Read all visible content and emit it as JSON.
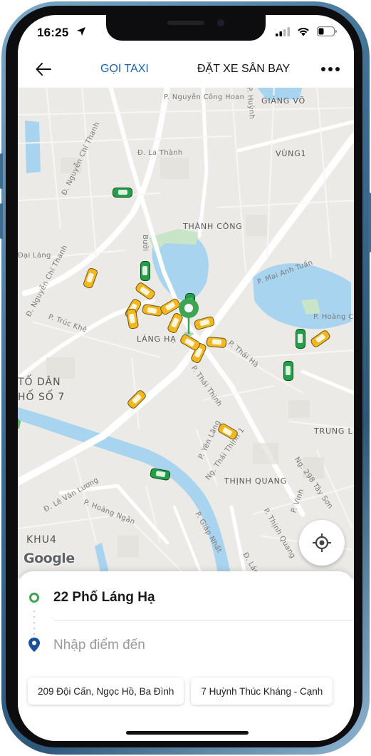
{
  "status_bar": {
    "time": "16:25"
  },
  "header": {
    "tabs": [
      {
        "label": "GỌI TAXI",
        "active": true
      },
      {
        "label": "ĐẶT XE SÂN BAY",
        "active": false
      }
    ],
    "accent_color": "#1c64b0"
  },
  "map": {
    "area_labels": [
      "GIẢNG VÕ",
      "VÙNG1",
      "THÀNH CÔNG",
      "LÁNG HẠ",
      "TỐ DÂN",
      "HỐ SỐ 7",
      "TRUNG L",
      "THỊNH QUANG",
      "KHU4"
    ],
    "street_labels": [
      "P. Nguyễn Công Hoan",
      "Đ. La Thành",
      "Đ. Nguyễn Chí Thanh",
      "Đ. Nguyễn Chí Thanh",
      "Đại Láng",
      "P. Trúc Khê",
      "P. Mai Anh Tuấn",
      "P. Hoàng Cầu",
      "P. Thái Hà",
      "P. Thái Thịnh",
      "P. Yên Lãng",
      "Ng. Thái Thịnh 1",
      "Ng. 298 Tây Sơn",
      "Đ. Lê Văn Lương",
      "P. Hoàng Ngân",
      "P. Giáp Nhất",
      "P. Vinh",
      "P. Thịnh Quang",
      "Đ. Lán",
      "Bưởi",
      "P. Huỳnh"
    ],
    "attribution": "Google"
  },
  "trip": {
    "pickup": "22 Phố Láng Hạ",
    "destination_placeholder": "Nhập điểm đến",
    "suggestions": [
      "209 Đội Cấn, Ngọc Hồ, Ba Đình",
      "7 Huỳnh Thúc Kháng - Cạnh"
    ]
  },
  "colors": {
    "pickup_green": "#3ea553",
    "taxi_yellow": "#f2b820",
    "taxi_green": "#22a047"
  }
}
